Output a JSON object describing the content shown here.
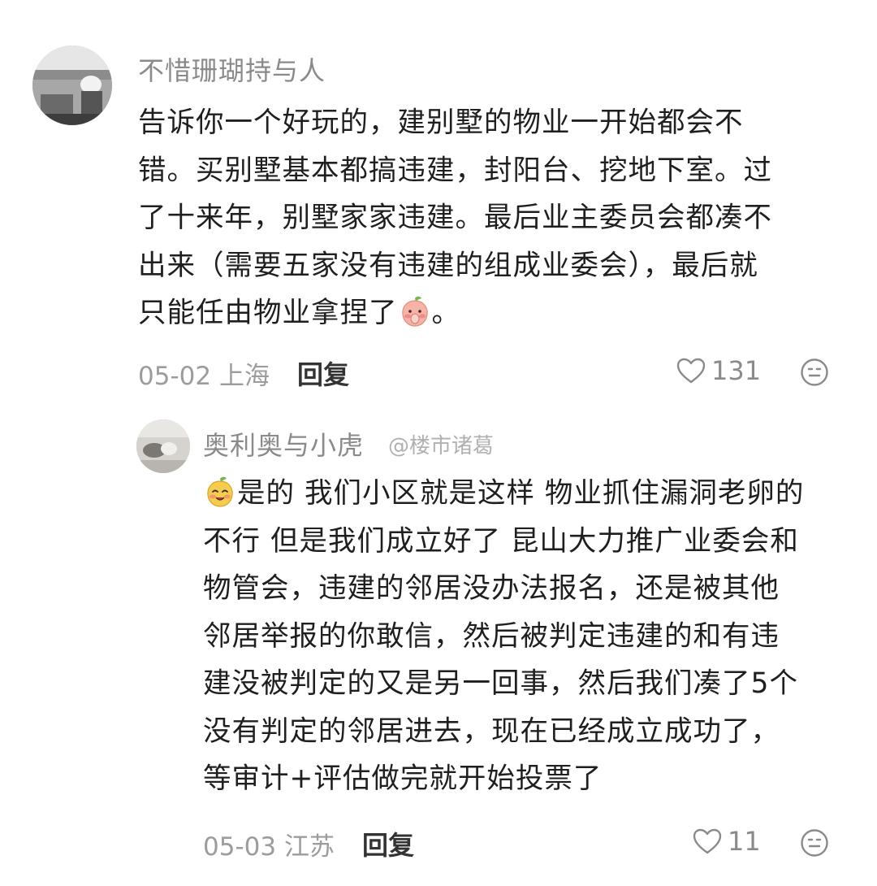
{
  "comments": [
    {
      "username": "不惜珊瑚持与人",
      "text_lines": [
        "告诉你一个好玩的，建别墅的物业一开始都会不",
        "错。买别墅基本都搞违建，封阳台、挖地下室。过",
        "了十来年，别墅家家违建。最后业主委员会都凑不",
        "出来（需要五家没有违建的组成业委会），最后就",
        "只能任由物业拿捏了"
      ],
      "text_tail": "。",
      "emoji": "peach-face-emoji",
      "date": "05-02",
      "location": "上海",
      "reply_label": "回复",
      "likes": "131"
    },
    {
      "username": "奥利奥与小虎",
      "text_lines": [
        "是的 我们小区就是这样 物业抓住漏洞老卵的",
        "不行 但是我们成立好了 昆山大力推广业委会和",
        "物管会，违建的邻居没办法报名，还是被其他",
        "邻居举报的你敢信，然后被判定违建的和有违",
        "建没被判定的又是另一回事，然后我们凑了5个",
        "没有判定的邻居进去，现在已经成立成功了，",
        "等审计+评估做完就开始投票了"
      ],
      "emoji": "yellow-peach-emoji",
      "date": "05-03",
      "location": "江苏",
      "reply_label": "回复",
      "likes": "11"
    }
  ],
  "watermark": "@楼市诸葛",
  "icons": {
    "like": "heart-outline-icon",
    "more": "emoji-face-icon"
  },
  "colors": {
    "text": "#1f1f1f",
    "meta": "#9c9c9c",
    "username": "#8a8a8a",
    "reply": "#333333"
  }
}
